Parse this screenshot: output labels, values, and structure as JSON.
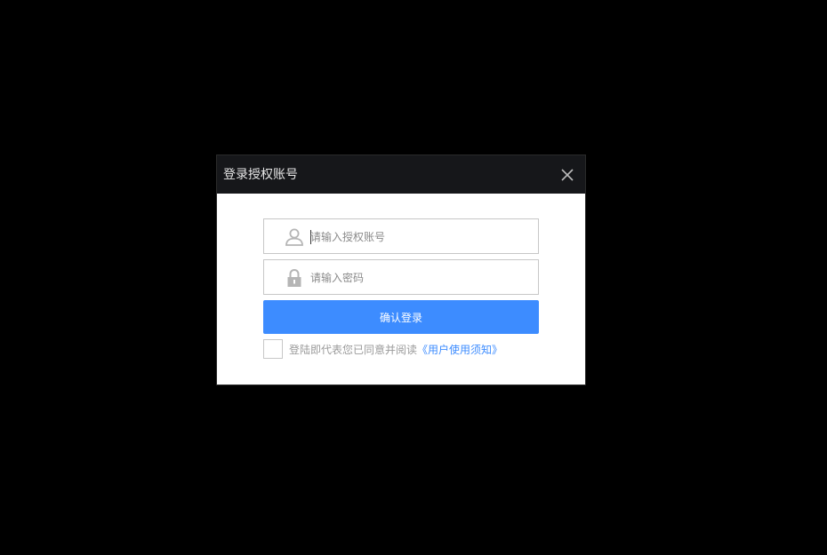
{
  "dialog": {
    "title": "登录授权账号",
    "close_icon": "close-icon"
  },
  "form": {
    "account": {
      "icon": "user-icon",
      "placeholder": "请输入授权账号",
      "value": ""
    },
    "password": {
      "icon": "lock-icon",
      "placeholder": "请输入密码",
      "value": ""
    },
    "confirm_label": "确认登录",
    "agreement": {
      "checked": false,
      "text": "登陆即代表您已同意并阅读",
      "link": "《用户使用须知》"
    }
  },
  "colors": {
    "overlay": "#000000",
    "titlebar": "#16171a",
    "primary": "#3d8cff",
    "border": "#c7c7c7",
    "muted_text": "#9a9a9a"
  }
}
